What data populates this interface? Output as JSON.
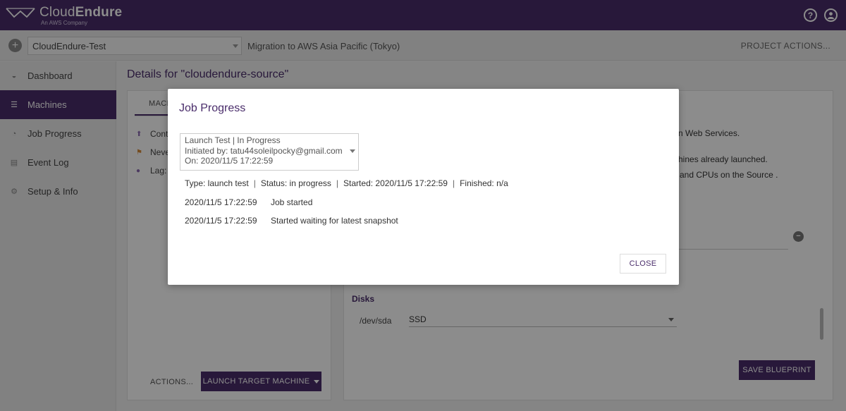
{
  "header": {
    "brand_prefix": "Cloud",
    "brand_bold": "Endure",
    "brand_sub": "An AWS Company",
    "help_icon": "?",
    "user_icon": "user-icon"
  },
  "project_bar": {
    "add_label": "+",
    "project_name": "CloudEndure-Test",
    "migration": "Migration to AWS Asia Pacific (Tokyo)",
    "actions": "PROJECT ACTIONS..."
  },
  "sidebar": {
    "items": [
      {
        "label": "Dashboard",
        "icon": "dashboard-icon"
      },
      {
        "label": "Machines",
        "icon": "machines-icon",
        "active": true
      },
      {
        "label": "Job Progress",
        "icon": "job-progress-icon"
      },
      {
        "label": "Event Log",
        "icon": "event-log-icon"
      },
      {
        "label": "Setup & Info",
        "icon": "gear-icon"
      }
    ]
  },
  "main": {
    "title": "Details for \"cloudendure-source\"",
    "left": {
      "tab": "MACH",
      "row1": "Cont",
      "row2": "Never",
      "row3": "Lag: n",
      "actions": "ACTIONS...",
      "launch": "LAUNCH TARGET MACHINE"
    },
    "right": {
      "line1": "n Web Services.",
      "line2": "hines already launched.",
      "line3": "and CPUs on the Source .",
      "disks_title": "Disks",
      "disk_device": "/dev/sda",
      "disk_type": "SSD",
      "save": "SAVE BLUEPRINT"
    }
  },
  "modal": {
    "title": "Job Progress",
    "job_select": {
      "line1": "Launch Test  |  In Progress",
      "line2": "Initiated by: tatu44soleilpocky@gmail.com",
      "line3": "On: 2020/11/5 17:22:59"
    },
    "summary": {
      "type": "Type: launch test",
      "status": "Status: in progress",
      "started": "Started: 2020/11/5 17:22:59",
      "finished": "Finished: n/a"
    },
    "log": [
      {
        "time": "2020/11/5 17:22:59",
        "message": "Job started"
      },
      {
        "time": "2020/11/5 17:22:59",
        "message": "Started waiting for latest snapshot"
      }
    ],
    "close": "CLOSE"
  }
}
